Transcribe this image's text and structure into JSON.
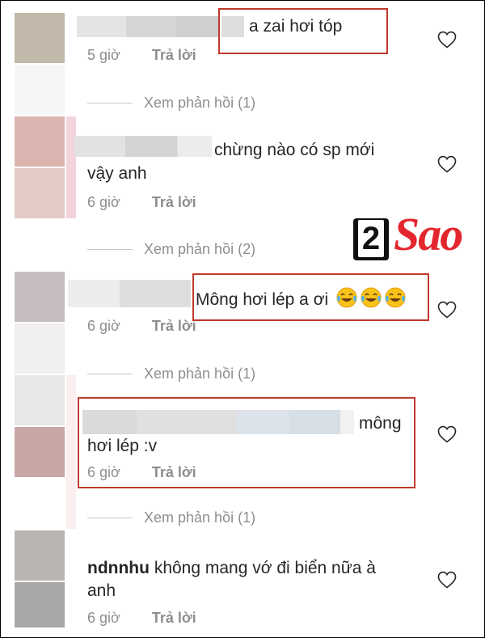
{
  "watermark": {
    "digit": "2",
    "word": "Sao"
  },
  "comments": [
    {
      "username": "",
      "text": "a zai hơi tóp",
      "time": "5 giờ",
      "reply_label": "Trả lời",
      "view_replies": "Xem phản hồi (1)"
    },
    {
      "username": "",
      "text_line1": "chừng nào có sp mới",
      "text_line2": "vậy anh",
      "time": "6 giờ",
      "reply_label": "Trả lời",
      "view_replies": "Xem phản hồi (2)"
    },
    {
      "username": "",
      "text": "Mông hơi lép  a ơi",
      "emoji": "tears-of-joy-emoji",
      "time": "6 giờ",
      "reply_label": "Trả lời",
      "view_replies": "Xem phản hồi (1)"
    },
    {
      "username": "",
      "text_line1": "mông",
      "text_line2": "hơi lép :v",
      "time": "6 giờ",
      "reply_label": "Trả lời",
      "view_replies": "Xem phản hồi (1)"
    },
    {
      "username": "ndnnhu",
      "text_line1": "không mang vớ đi biển nữa à",
      "text_line2": "anh",
      "time": "6 giờ",
      "reply_label": "Trả lời"
    }
  ],
  "icons": {
    "like": "heart-outline-icon",
    "emoji": "tears-of-joy-emoji"
  },
  "colors": {
    "highlight_box": "#c0392b",
    "muted_text": "#8e8e8e",
    "logo_red": "#e3262d"
  }
}
